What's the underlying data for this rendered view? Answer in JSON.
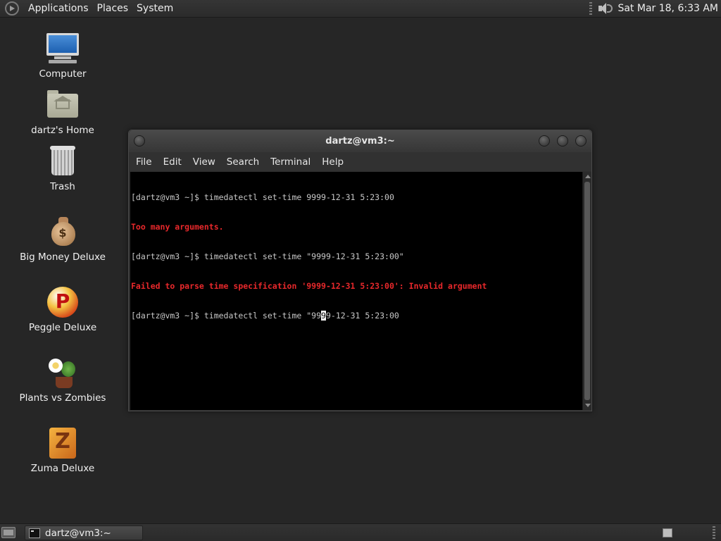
{
  "top_panel": {
    "menus": [
      "Applications",
      "Places",
      "System"
    ],
    "clock": "Sat Mar 18,  6:33 AM",
    "icons": [
      "gnome-foot-icon",
      "speaker-icon"
    ]
  },
  "desktop": {
    "icons": [
      {
        "label": "Computer",
        "icon": "computer-icon"
      },
      {
        "label": "dartz's Home",
        "icon": "home-folder-icon"
      },
      {
        "label": "Trash",
        "icon": "trash-icon"
      },
      {
        "label": "Big Money Deluxe",
        "icon": "money-bag-icon"
      },
      {
        "label": "Peggle Deluxe",
        "icon": "peggle-icon"
      },
      {
        "label": "Plants vs Zombies",
        "icon": "plants-vs-zombies-icon"
      },
      {
        "label": "Zuma Deluxe",
        "icon": "zuma-icon"
      }
    ]
  },
  "terminal": {
    "title": "dartz@vm3:~",
    "menus": [
      "File",
      "Edit",
      "View",
      "Search",
      "Terminal",
      "Help"
    ],
    "lines": [
      {
        "text": "[dartz@vm3 ~]$ timedatectl set-time 9999-12-31 5:23:00",
        "type": "normal"
      },
      {
        "text": "Too many arguments.",
        "type": "error"
      },
      {
        "text": "[dartz@vm3 ~]$ timedatectl set-time \"9999-12-31 5:23:00\"",
        "type": "normal"
      },
      {
        "text": "Failed to parse time specification '9999-12-31 5:23:00': Invalid argument",
        "type": "error"
      }
    ],
    "current_line": {
      "before_cursor": "[dartz@vm3 ~]$ timedatectl set-time \"99",
      "cursor_char": "9",
      "after_cursor": "9-12-31 5:23:00"
    }
  },
  "bottom_panel": {
    "task_label": "dartz@vm3:~"
  },
  "colors": {
    "desktop_bg": "#262626",
    "terminal_bg": "#000000",
    "error_text": "#e8282b",
    "normal_text": "#c8c8c8"
  }
}
